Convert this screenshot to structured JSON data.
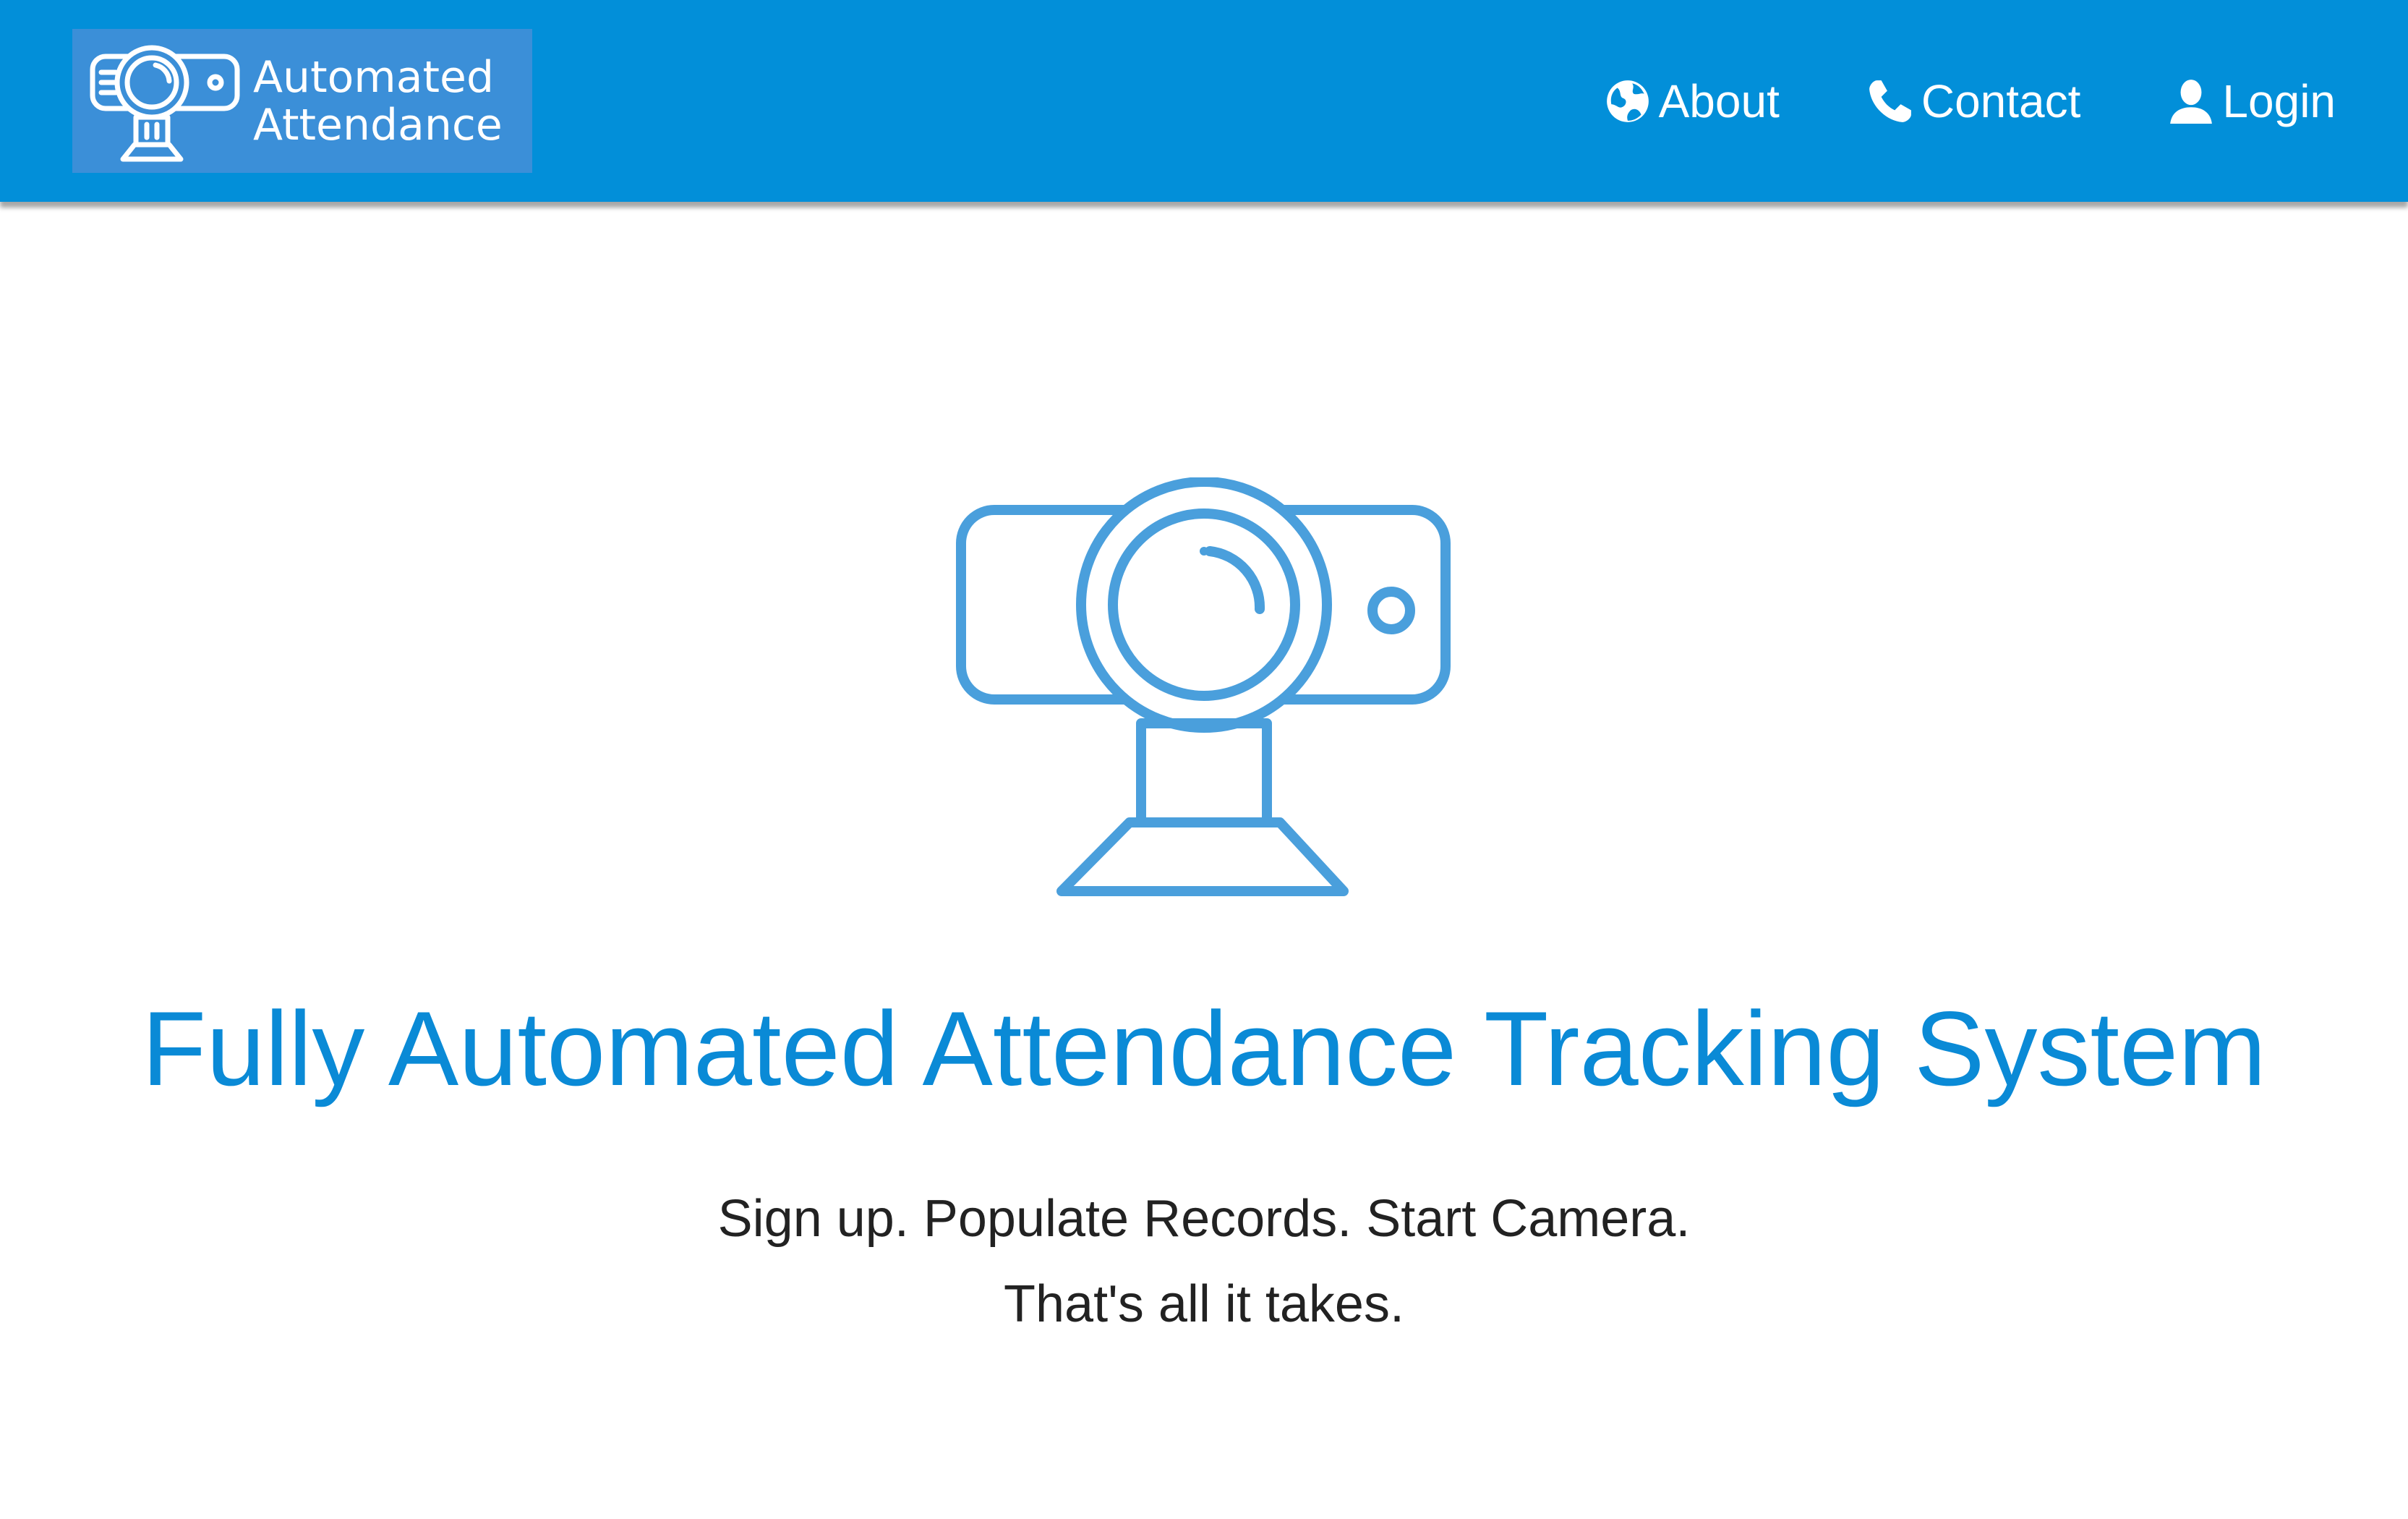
{
  "colors": {
    "navbar_bg": "#028fd9",
    "brand_bg": "#3b8fd8",
    "title_color": "#0a8ad6",
    "camera_stroke": "#4a9fdc",
    "text_color": "#222222"
  },
  "navbar": {
    "brand": {
      "line1": "Automated",
      "line2": "Attendance",
      "logo_icon": "webcam-icon"
    },
    "links": [
      {
        "label": "About",
        "icon": "globe-icon"
      },
      {
        "label": "Contact",
        "icon": "phone-icon"
      },
      {
        "label": "Login",
        "icon": "user-icon"
      }
    ]
  },
  "hero": {
    "image_icon": "webcam-icon",
    "title": "Fully Automated Attendance Tracking System",
    "tagline_line1": "Sign up. Populate Records. Start Camera.",
    "tagline_line2": "That's all it takes."
  }
}
